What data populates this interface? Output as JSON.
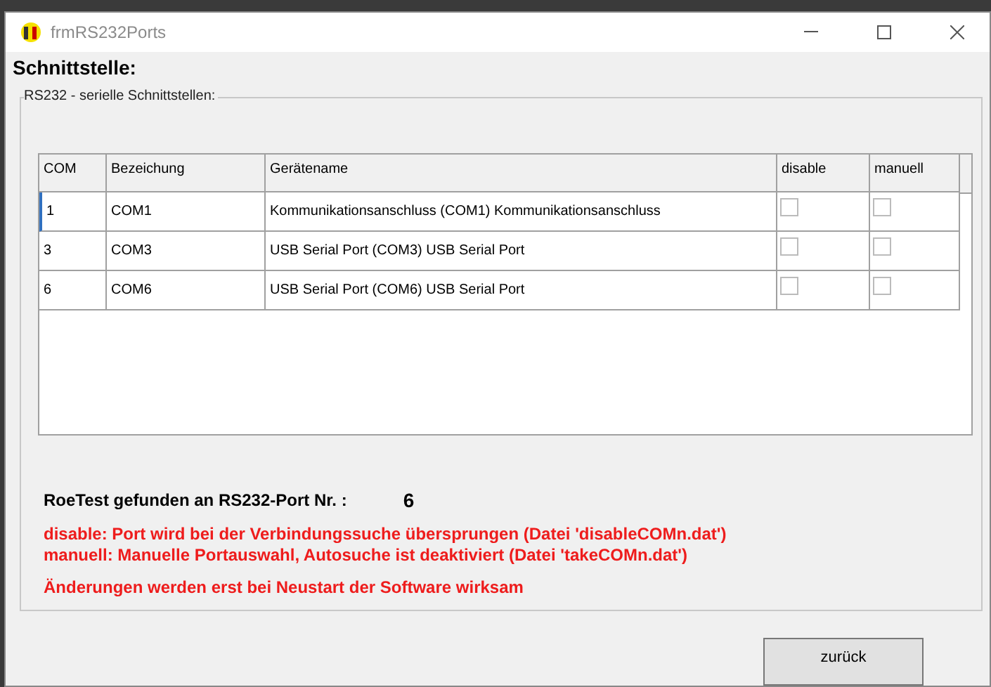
{
  "window": {
    "title": "frmRS232Ports"
  },
  "heading": "Schnittstelle:",
  "group": {
    "legend": "RS232 - serielle Schnittstellen:"
  },
  "table": {
    "columns": [
      "COM",
      "Bezeichung",
      "Gerätename",
      "disable",
      "manuell"
    ],
    "rows": [
      {
        "com": "1",
        "name": "COM1",
        "device": "Kommunikationsanschluss (COM1) Kommunikationsanschluss",
        "disable": false,
        "manual": false,
        "selected": true
      },
      {
        "com": "3",
        "name": "COM3",
        "device": "USB Serial Port (COM3) USB Serial Port",
        "disable": false,
        "manual": false,
        "selected": false
      },
      {
        "com": "6",
        "name": "COM6",
        "device": "USB Serial Port (COM6) USB Serial Port",
        "disable": false,
        "manual": false,
        "selected": false
      }
    ]
  },
  "found": {
    "label": "RoeTest gefunden  an RS232-Port Nr. :",
    "value": "6"
  },
  "notes": [
    "disable: Port wird bei der Verbindungssuche übersprungen (Datei 'disableCOMn.dat')",
    "manuell: Manuelle Portauswahl, Autosuche ist deaktiviert (Datei 'takeCOMn.dat')",
    "Änderungen werden erst bei Neustart der Software wirksam"
  ],
  "buttons": [
    "zurück"
  ]
}
